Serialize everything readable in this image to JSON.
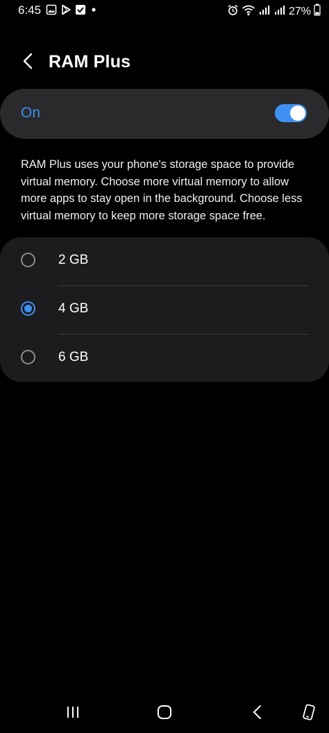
{
  "status_bar": {
    "time": "6:45",
    "battery": "27%",
    "left_icons": [
      "gallery-icon",
      "play-store-icon",
      "check-icon",
      "dot-icon"
    ],
    "right_icons": [
      "alarm-icon",
      "wifi-icon",
      "signal-icon",
      "signal-icon",
      "battery-icon"
    ]
  },
  "header": {
    "title": "RAM Plus",
    "back_icon": "chevron-left-icon"
  },
  "master_toggle": {
    "label": "On",
    "state": "on"
  },
  "description": "RAM Plus uses your phone's storage space to provide virtual memory. Choose more virtual memory to allow more apps to stay open in the background. Choose less virtual memory to keep more storage space free.",
  "options": [
    {
      "label": "2 GB",
      "selected": false
    },
    {
      "label": "4 GB",
      "selected": true
    },
    {
      "label": "6 GB",
      "selected": false
    }
  ],
  "nav_bar": {
    "items": [
      "recents-icon",
      "home-icon",
      "back-icon",
      "rotate-icon"
    ]
  },
  "colors": {
    "accent": "#3e91f2",
    "card": "#2a2a2c",
    "list_card": "#1c1c1e",
    "background": "#000000"
  }
}
